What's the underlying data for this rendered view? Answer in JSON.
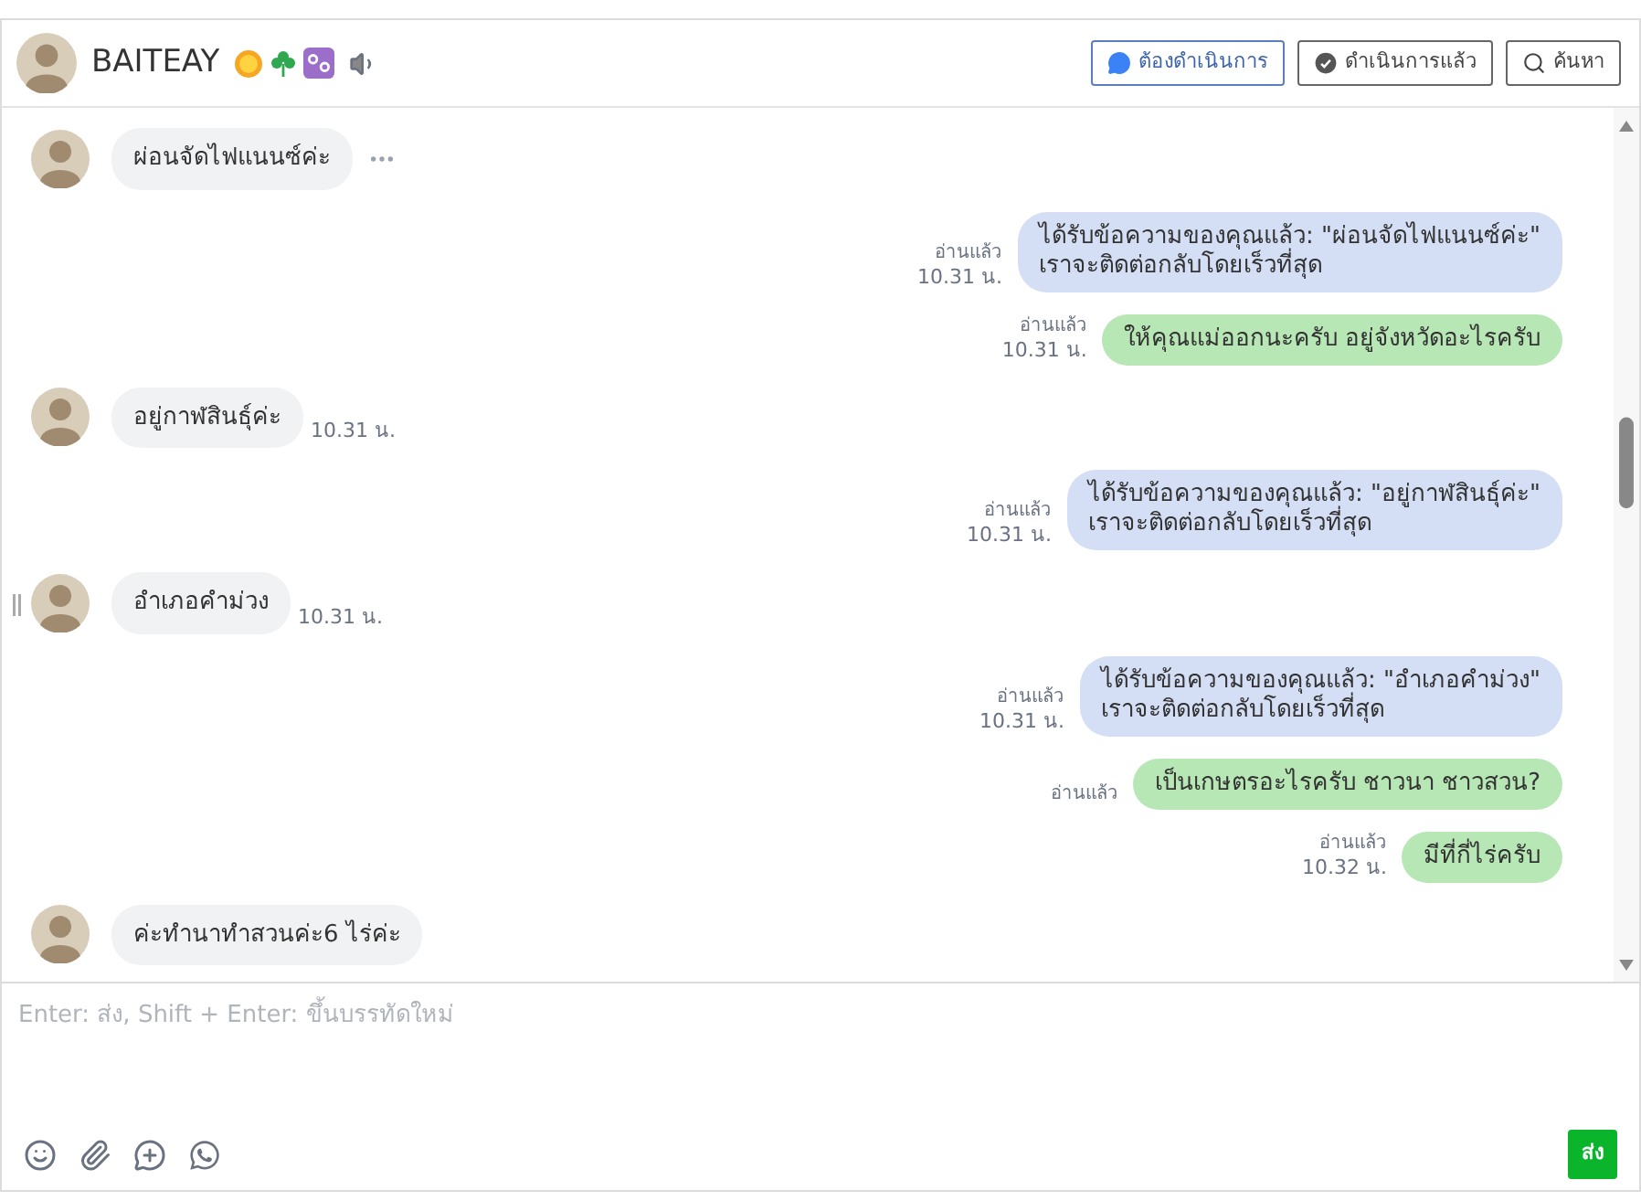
{
  "header": {
    "name": "BAITEAY"
  },
  "filters": [
    {
      "label": "ต้องดำเนินการ",
      "kind": "todo",
      "selected": true
    },
    {
      "label": "ดำเนินการแล้ว",
      "kind": "done",
      "selected": false
    },
    {
      "label": "ค้นหา",
      "kind": "search",
      "selected": false
    }
  ],
  "messages": [
    {
      "kind": "incoming",
      "text": "ผ่อนจัดไฟแนนซ์ค่ะ",
      "more": true
    },
    {
      "kind": "auto",
      "text": "ได้รับข้อความของคุณแล้ว: \"ผ่อนจัดไฟแนนซ์ค่ะ\"\nเราจะติดต่อกลับโดยเร็วที่สุด",
      "read": "อ่านแล้ว",
      "time": "10.31 น."
    },
    {
      "kind": "outgoing",
      "text": "ให้คุณแม่ออกนะครับ อยู่จังหวัดอะไรครับ",
      "read": "อ่านแล้ว",
      "time": "10.31 น."
    },
    {
      "kind": "incoming",
      "text": "อยู่กาฬสินธุ์ค่ะ",
      "time": "10.31 น."
    },
    {
      "kind": "auto",
      "text": "ได้รับข้อความของคุณแล้ว: \"อยู่กาฬสินธุ์ค่ะ\"\nเราจะติดต่อกลับโดยเร็วที่สุด",
      "read": "อ่านแล้ว",
      "time": "10.31 น."
    },
    {
      "kind": "incoming",
      "text": "อำเภอคำม่วง",
      "time": "10.31 น."
    },
    {
      "kind": "auto",
      "text": "ได้รับข้อความของคุณแล้ว: \"อำเภอคำม่วง\"\nเราจะติดต่อกลับโดยเร็วที่สุด",
      "read": "อ่านแล้ว",
      "time": "10.31 น."
    },
    {
      "kind": "outgoing",
      "text": "เป็นเกษตรอะไรครับ ชาวนา ชาวสวน?",
      "read": "อ่านแล้ว"
    },
    {
      "kind": "outgoing",
      "text": "มีที่กี่ไร่ครับ",
      "read": "อ่านแล้ว",
      "time": "10.32 น."
    },
    {
      "kind": "incoming",
      "text": "ค่ะทำนาทำสวนค่ะ6 ไร่ค่ะ"
    }
  ],
  "composer": {
    "placeholder": "Enter: ส่ง, Shift + Enter: ขึ้นบรรทัดใหม่",
    "send": "ส่ง"
  }
}
